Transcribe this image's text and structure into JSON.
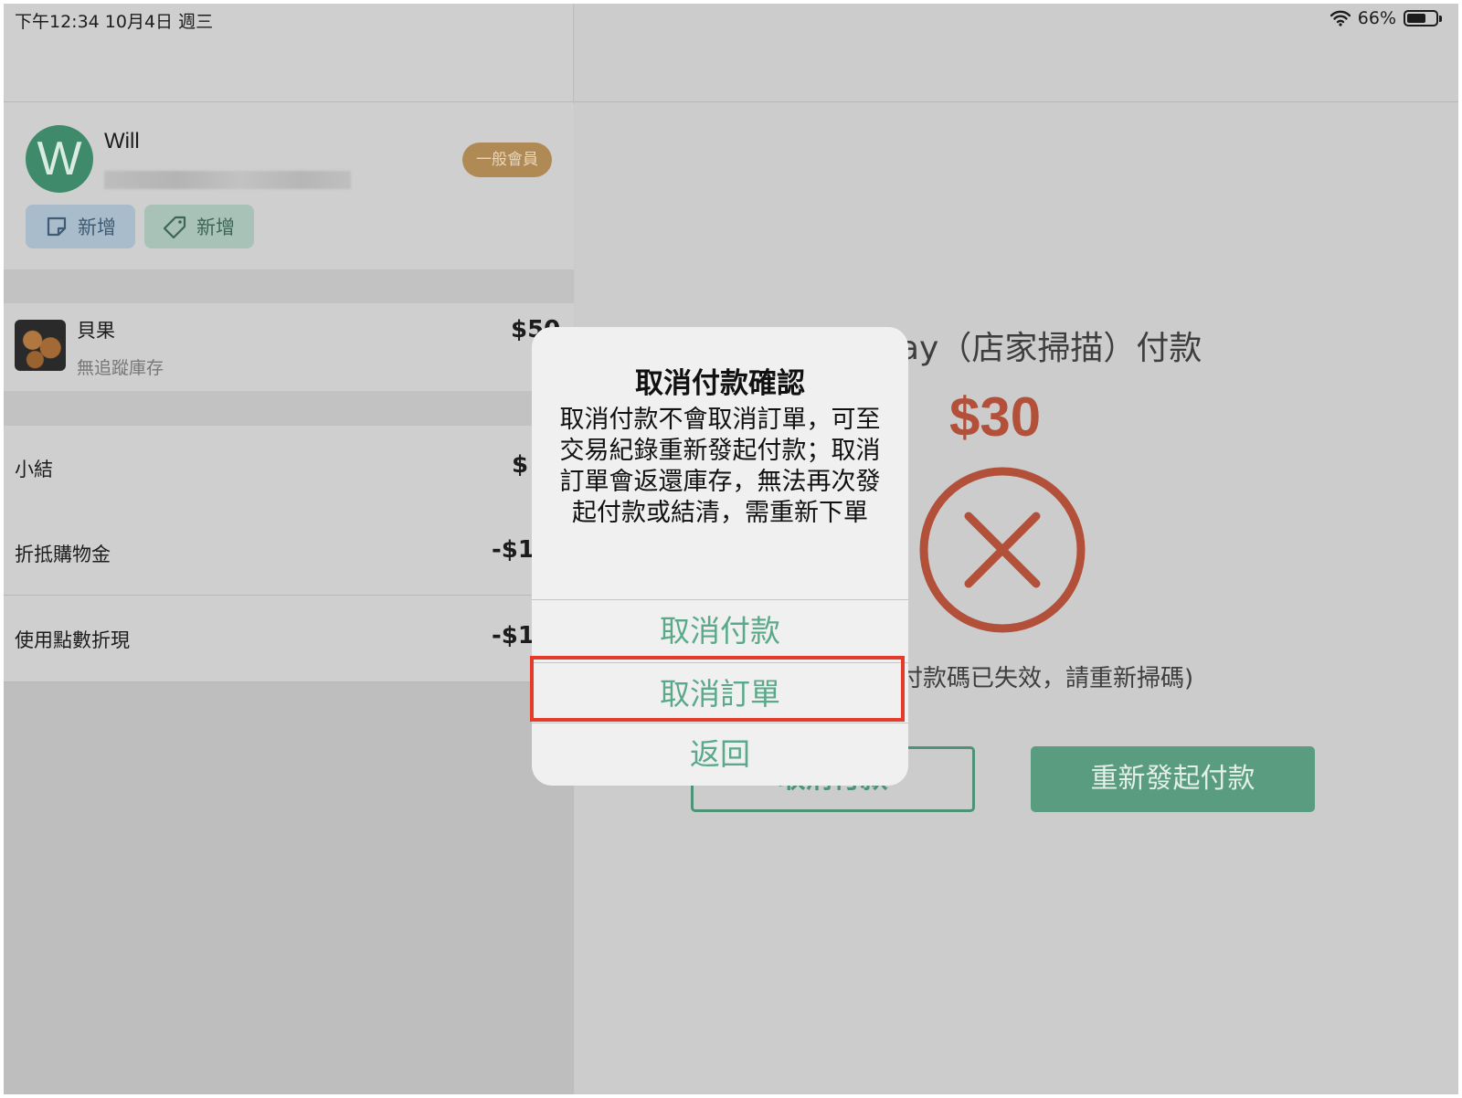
{
  "status_bar": {
    "time_date": "下午12:34   10月4日 週三",
    "battery_percent": "66%",
    "battery_level": 0.66
  },
  "member": {
    "initial": "W",
    "name": "Will",
    "badge": "一般會員",
    "note_chip_label": "新增",
    "tag_chip_label": "新增"
  },
  "order": {
    "item": {
      "name": "貝果",
      "inventory_note": "無追蹤庫存",
      "price": "$50"
    },
    "summary": [
      {
        "label": "小結",
        "value": "$"
      },
      {
        "label": "折抵購物金",
        "value": "-$1"
      },
      {
        "label": "使用點數折現",
        "value": "-$1"
      }
    ]
  },
  "payment": {
    "title": "ay（店家掃描）付款",
    "amount": "$30",
    "status_message": "付款碼已失效，請重新掃碼)",
    "cancel_payment_button": "取消付款",
    "retry_button": "重新發起付款"
  },
  "alert": {
    "title": "取消付款確認",
    "message": "取消付款不會取消訂單，可至交易紀錄重新發起付款；取消訂單會返還庫存，無法再次發起付款或結清，需重新下單",
    "buttons": {
      "cancel_payment": "取消付款",
      "cancel_order": "取消訂單",
      "back": "返回"
    }
  },
  "colors": {
    "accent_green": "#5aa98a",
    "error_red": "#b2503a",
    "highlight": "#e63b2a",
    "badge_gold": "#b08a54"
  }
}
